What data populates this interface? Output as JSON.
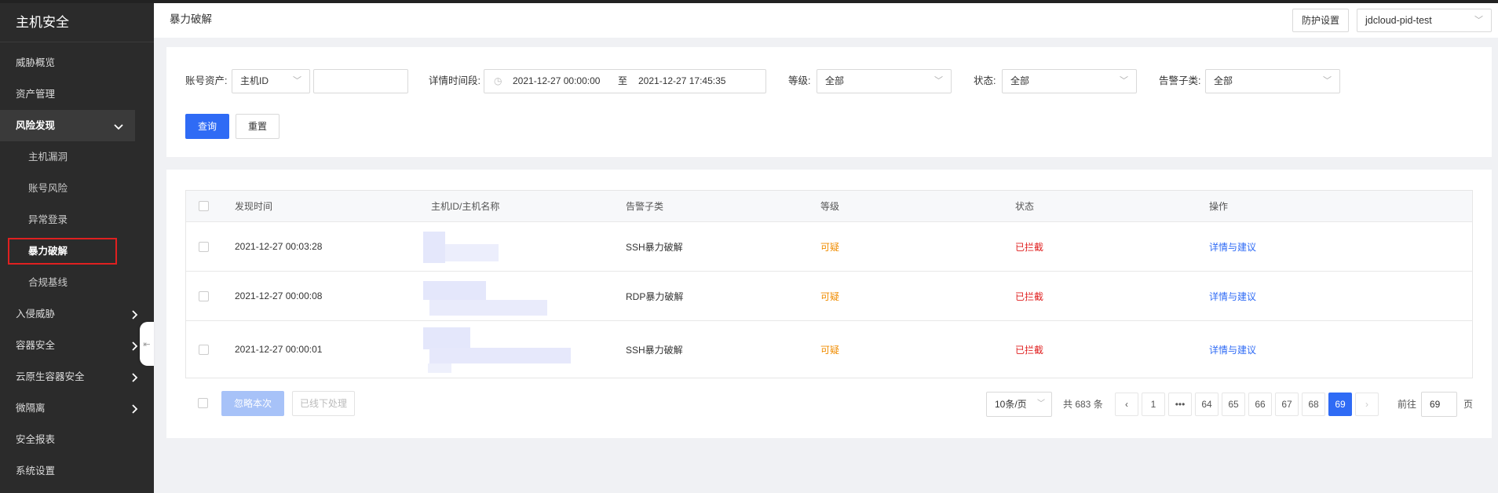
{
  "sidebar": {
    "title": "主机安全",
    "items": [
      {
        "label": "威胁概览"
      },
      {
        "label": "资产管理"
      },
      {
        "label": "风险发现"
      },
      {
        "label": "主机漏洞"
      },
      {
        "label": "账号风险"
      },
      {
        "label": "异常登录"
      },
      {
        "label": "暴力破解"
      },
      {
        "label": "合规基线"
      },
      {
        "label": "入侵威胁"
      },
      {
        "label": "容器安全"
      },
      {
        "label": "云原生容器安全"
      },
      {
        "label": "微隔离"
      },
      {
        "label": "安全报表"
      },
      {
        "label": "系统设置"
      }
    ],
    "collapse_icon": "collapse-icon"
  },
  "header": {
    "title": "暴力破解",
    "protect_button": "防护设置",
    "project_select": "jdcloud-pid-test"
  },
  "filters": {
    "asset_label": "账号资产:",
    "asset_select": "主机ID",
    "asset_input": "",
    "time_label": "详情时间段:",
    "time_start": "2021-12-27 00:00:00",
    "time_sep": "至",
    "time_end": "2021-12-27 17:45:35",
    "level_label": "等级:",
    "level_value": "全部",
    "status_label": "状态:",
    "status_value": "全部",
    "subtype_label": "告警子类:",
    "subtype_value": "全部",
    "query_button": "查询",
    "reset_button": "重置"
  },
  "table": {
    "columns": [
      "发现时间",
      "主机ID/主机名称",
      "告警子类",
      "等级",
      "状态",
      "操作"
    ],
    "rows": [
      {
        "time": "2021-12-27 00:03:28",
        "host": "",
        "subtype": "SSH暴力破解",
        "level": "可疑",
        "status": "已拦截",
        "action": "详情与建议"
      },
      {
        "time": "2021-12-27 00:00:08",
        "host": "",
        "subtype": "RDP暴力破解",
        "level": "可疑",
        "status": "已拦截",
        "action": "详情与建议"
      },
      {
        "time": "2021-12-27 00:00:01",
        "host": "",
        "subtype": "SSH暴力破解",
        "level": "可疑",
        "status": "已拦截",
        "action": "详情与建议"
      }
    ]
  },
  "bulk": {
    "ignore_button": "忽略本次",
    "offline_button": "已线下处理"
  },
  "pagination": {
    "page_size": "10条/页",
    "total": "共 683 条",
    "pages": [
      "1",
      "•••",
      "64",
      "65",
      "66",
      "67",
      "68",
      "69"
    ],
    "current": "69",
    "goto_label": "前往",
    "goto_value": "69",
    "goto_unit": "页"
  },
  "colors": {
    "primary": "#2f6bf5",
    "warning": "#f08c00",
    "danger": "#e02020",
    "sidebar_bg": "#2b2b2b"
  }
}
